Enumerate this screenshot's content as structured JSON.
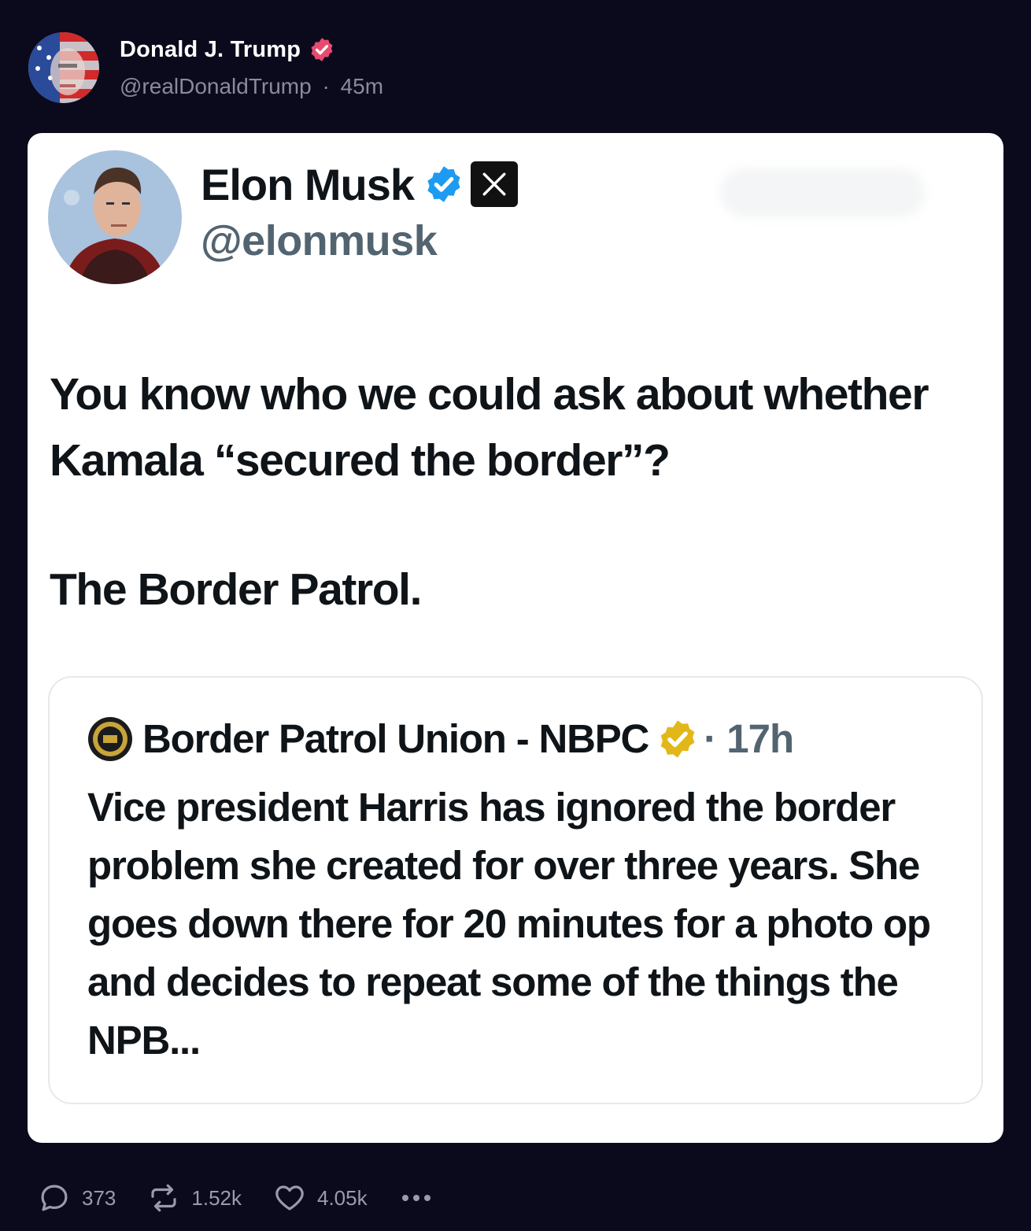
{
  "post": {
    "author_name": "Donald J. Trump",
    "handle": "@realDonaldTrump",
    "separator": "·",
    "time": "45m",
    "verified_color": "#e64b6f"
  },
  "embed": {
    "author_name": "Elon Musk",
    "handle": "@elonmusk",
    "x_label": "X",
    "text_line1": "You know who we could ask about whether Kamala “secured the border”?",
    "text_line2": "The Border Patrol.",
    "quote": {
      "author_name": "Border Patrol Union - NBPC",
      "time": "· 17h",
      "body": "Vice president Harris has ignored the border problem she created for over three years. She goes down there for 20 minutes for a photo op and decides to repeat some of the things the NPB..."
    }
  },
  "actions": {
    "replies": "373",
    "reposts": "1.52k",
    "likes": "4.05k"
  },
  "colors": {
    "background": "#0b0a1c",
    "card": "#ffffff",
    "blue_check": "#1d9bf0",
    "gold_check": "#e2b719"
  }
}
